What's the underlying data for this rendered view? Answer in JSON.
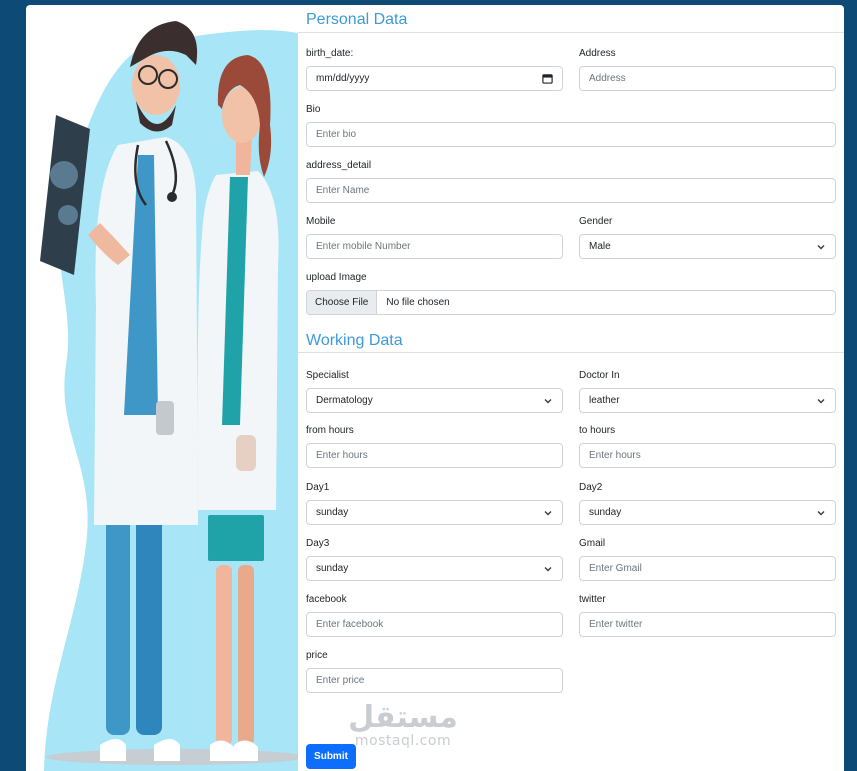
{
  "personal": {
    "title": "Personal Data",
    "birth_date": {
      "label": "birth_date:",
      "value": "mm/dd/yyyy"
    },
    "address": {
      "label": "Address",
      "placeholder": "Address"
    },
    "bio": {
      "label": "Bio",
      "placeholder": "Enter bio"
    },
    "address_detail": {
      "label": "address_detail",
      "placeholder": "Enter Name"
    },
    "mobile": {
      "label": "Mobile",
      "placeholder": "Enter mobile Number"
    },
    "gender": {
      "label": "Gender",
      "value": "Male"
    },
    "upload": {
      "label": "upload Image",
      "button": "Choose File",
      "status": "No file chosen"
    }
  },
  "working": {
    "title": "Working Data",
    "specialist": {
      "label": "Specialist",
      "value": "Dermatology"
    },
    "doctor_in": {
      "label": "Doctor In",
      "value": "leather"
    },
    "from_hours": {
      "label": "from hours",
      "placeholder": "Enter hours"
    },
    "to_hours": {
      "label": "to hours",
      "placeholder": "Enter hours"
    },
    "day1": {
      "label": "Day1",
      "value": "sunday"
    },
    "day2": {
      "label": "Day2",
      "value": "sunday"
    },
    "day3": {
      "label": "Day3",
      "value": "sunday"
    },
    "gmail": {
      "label": "Gmail",
      "placeholder": "Enter Gmail"
    },
    "facebook": {
      "label": "facebook",
      "placeholder": "Enter facebook"
    },
    "twitter": {
      "label": "twitter",
      "placeholder": "Enter twitter"
    },
    "price": {
      "label": "price",
      "placeholder": "Enter price"
    }
  },
  "submit_label": "Submit",
  "watermark": {
    "arabic": "مستقل",
    "latin": "mostaql.com"
  },
  "colors": {
    "page_background": "#0d4a75",
    "section_title": "#3d9ad9",
    "primary_button": "#0d6efd",
    "illustration_blob": "#a8e6f7"
  },
  "icons": [
    "chevron-down-icon",
    "calendar-icon"
  ]
}
